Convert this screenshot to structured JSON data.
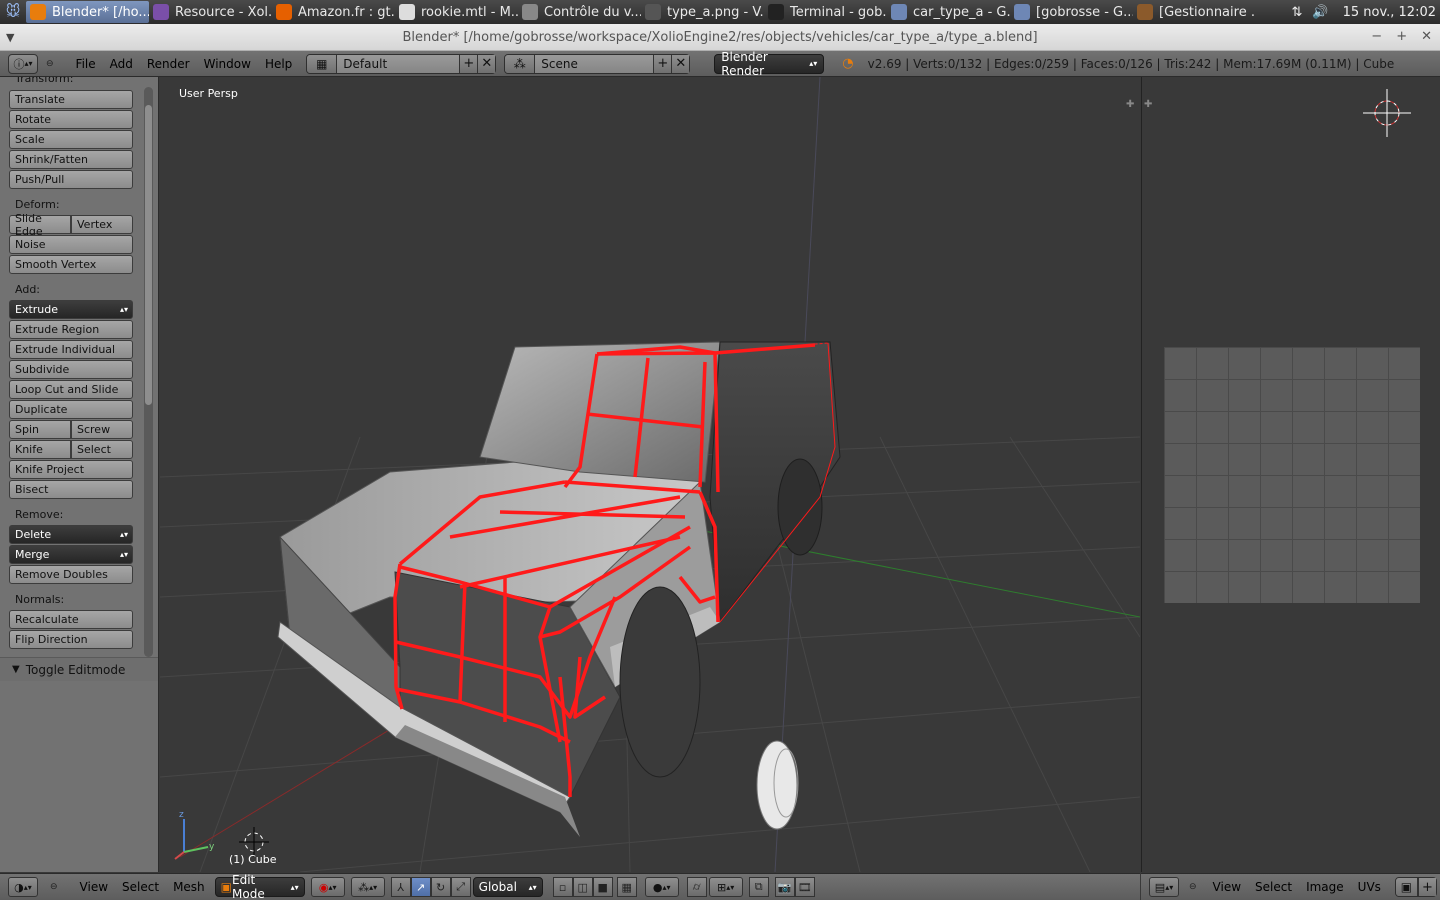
{
  "taskbar": {
    "tasks": [
      {
        "label": "Blender* [/ho...",
        "icon": "blender-icon",
        "color": "#e87d0d",
        "active": true
      },
      {
        "label": "Resource - Xol...",
        "icon": "browser-icon",
        "color": "#7a4fa8"
      },
      {
        "label": "Amazon.fr : gt...",
        "icon": "firefox-icon",
        "color": "#e66000"
      },
      {
        "label": "rookie.mtl - M...",
        "icon": "text-editor-icon",
        "color": "#dddddd"
      },
      {
        "label": "Contrôle du v...",
        "icon": "volume-control-icon",
        "color": "#888888"
      },
      {
        "label": "type_a.png - V...",
        "icon": "image-viewer-icon",
        "color": "#555555"
      },
      {
        "label": "Terminal - gob...",
        "icon": "terminal-icon",
        "color": "#222222"
      },
      {
        "label": "car_type_a - G...",
        "icon": "folder-icon",
        "color": "#6e87b5"
      },
      {
        "label": "[gobrosse - G...",
        "icon": "folder-icon",
        "color": "#6e87b5"
      },
      {
        "label": "[Gestionnaire ...",
        "icon": "gimp-icon",
        "color": "#8b5a2b"
      }
    ],
    "clock": "15 nov., 12:02"
  },
  "window": {
    "title": "Blender* [/home/gobrosse/workspace/XolioEngine2/res/objects/vehicles/car_type_a/type_a.blend]"
  },
  "top_header": {
    "menus": [
      "File",
      "Add",
      "Render",
      "Window",
      "Help"
    ],
    "screen_layout": "Default",
    "scene": "Scene",
    "render_engine": "Blender Render",
    "stats": "v2.69 | Verts:0/132 | Edges:0/259 | Faces:0/126 | Tris:242 | Mem:17.69M (0.11M) | Cube"
  },
  "tool_shelf": {
    "transform_label": "Transform:",
    "translate": "Translate",
    "rotate": "Rotate",
    "scale": "Scale",
    "shrink_fatten": "Shrink/Fatten",
    "push_pull": "Push/Pull",
    "deform_label": "Deform:",
    "slide_edge": "Slide Edge",
    "vertex": "Vertex",
    "noise": "Noise",
    "smooth_vertex": "Smooth Vertex",
    "add_label": "Add:",
    "extrude": "Extrude",
    "extrude_region": "Extrude Region",
    "extrude_individual": "Extrude Individual",
    "subdivide": "Subdivide",
    "loop_cut": "Loop Cut and Slide",
    "duplicate": "Duplicate",
    "spin": "Spin",
    "screw": "Screw",
    "knife": "Knife",
    "select": "Select",
    "knife_project": "Knife Project",
    "bisect": "Bisect",
    "remove_label": "Remove:",
    "delete": "Delete",
    "merge": "Merge",
    "remove_doubles": "Remove Doubles",
    "normals_label": "Normals:",
    "recalculate": "Recalculate",
    "flip_direction": "Flip Direction",
    "toggle_editmode": "Toggle Editmode"
  },
  "viewport": {
    "view_name": "User Persp",
    "object_label": "(1) Cube",
    "header": {
      "menus": [
        "View",
        "Select",
        "Mesh"
      ],
      "mode": "Edit Mode",
      "orientation": "Global"
    }
  },
  "uv_editor": {
    "header": {
      "menus": [
        "View",
        "Select",
        "Image",
        "UVs"
      ]
    }
  },
  "colors": {
    "selection_red": "#ff1a1a",
    "blender_orange": "#e87d0d",
    "background": "#393939"
  }
}
